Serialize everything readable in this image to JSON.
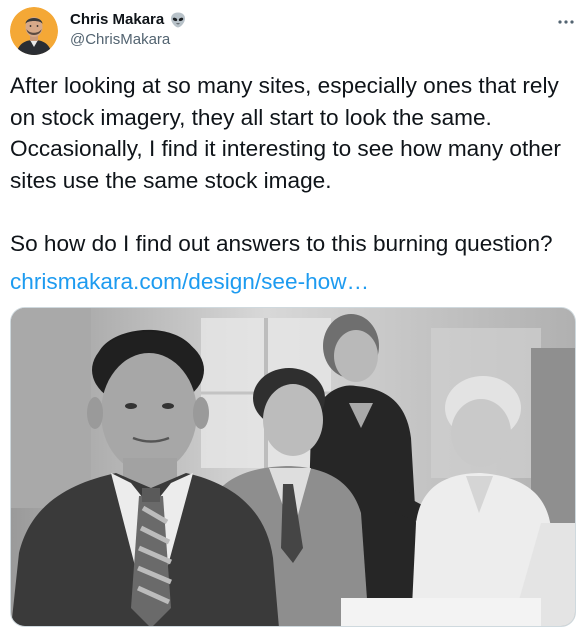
{
  "author": {
    "display_name": "Chris Makara",
    "handle": "@ChrisMakara",
    "name_emoji_icon": "alien-icon",
    "avatar_icon": "avatar-photo",
    "avatar_bg": "#f4a836"
  },
  "menu": {
    "icon": "more-horizontal-icon"
  },
  "tweet": {
    "text": "After looking at so many sites, especially ones that rely on stock imagery, they all start to look the same. Occasionally, I find it interesting to see how many other sites use the same stock image.\n\nSo how do I find out answers to this burning question?",
    "link": "chrismakara.com/design/see-how…",
    "link_color": "#1d9bf0"
  },
  "media": {
    "kind": "grayscale stock photo",
    "icon": "photo-attachment"
  }
}
